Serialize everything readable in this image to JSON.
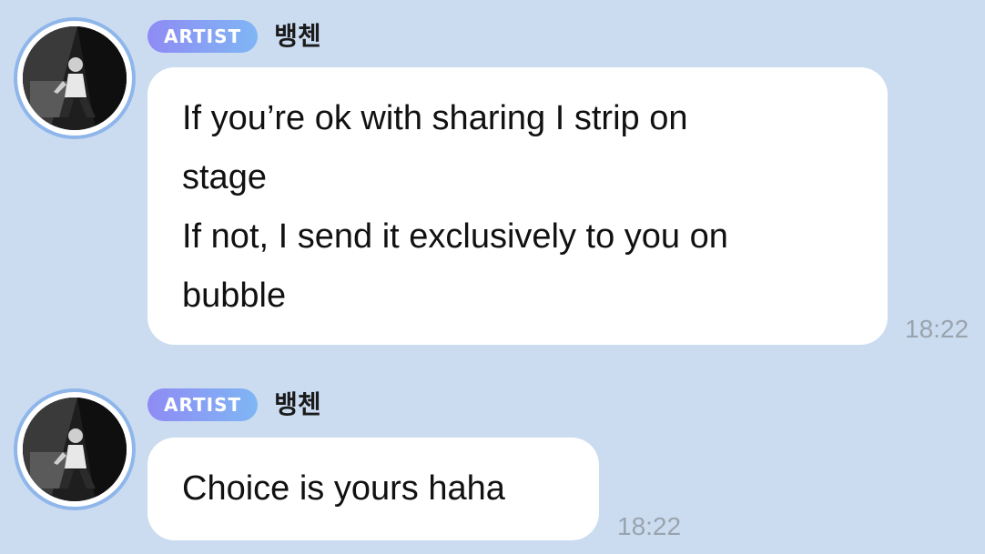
{
  "messages": [
    {
      "badge": "ARTIST",
      "sender": "뱅첸",
      "lines": [
        "If you’re ok with sharing I strip on",
        "stage",
        "If not, I send it exclusively to you on",
        "bubble"
      ],
      "time": "18:22"
    },
    {
      "badge": "ARTIST",
      "sender": "뱅첸",
      "lines": [
        "Choice is yours haha"
      ],
      "time": "18:22"
    }
  ],
  "colors": {
    "background": "#cbdcf1",
    "bubble": "#ffffff",
    "badge_gradient_start": "#8f8bf4",
    "badge_gradient_end": "#7fb6f4",
    "avatar_ring": "#8fb6ea",
    "timestamp": "#9aa3ad"
  }
}
